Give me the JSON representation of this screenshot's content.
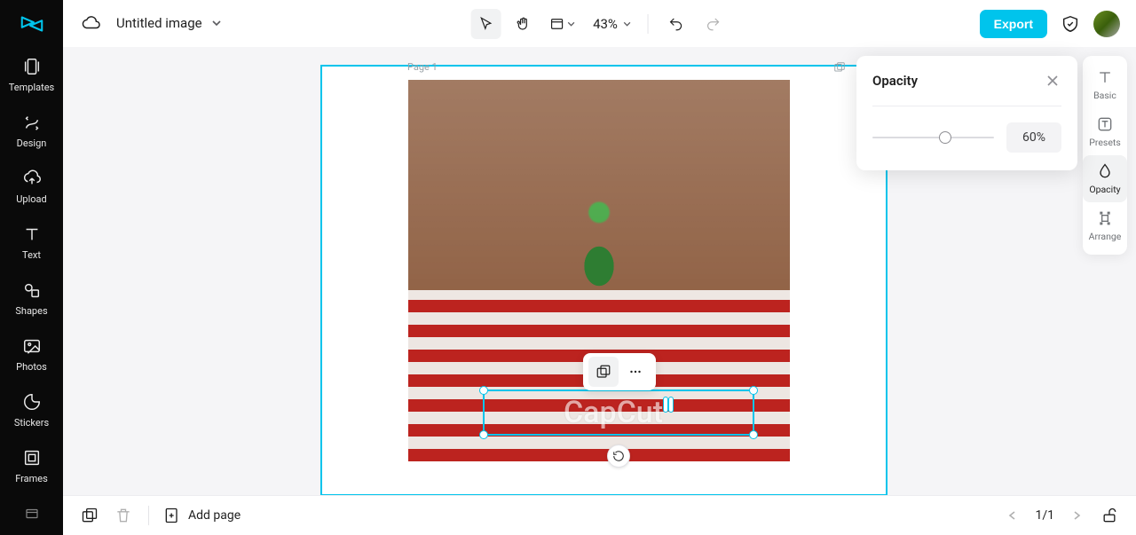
{
  "header": {
    "title": "Untitled image",
    "zoom": "43%",
    "export_label": "Export"
  },
  "sidebar": {
    "items": [
      {
        "label": "Templates"
      },
      {
        "label": "Design"
      },
      {
        "label": "Upload"
      },
      {
        "label": "Text"
      },
      {
        "label": "Shapes"
      },
      {
        "label": "Photos"
      },
      {
        "label": "Stickers"
      },
      {
        "label": "Frames"
      }
    ]
  },
  "canvas": {
    "page_label": "Page 1",
    "selected_text": "CapCut"
  },
  "right_tabs": {
    "items": [
      {
        "label": "Basic"
      },
      {
        "label": "Presets"
      },
      {
        "label": "Opacity"
      },
      {
        "label": "Arrange"
      }
    ],
    "active_index": 2
  },
  "opacity_panel": {
    "title": "Opacity",
    "value": "60%",
    "percent": 60
  },
  "footer": {
    "add_page_label": "Add page",
    "page_indicator": "1/1"
  }
}
